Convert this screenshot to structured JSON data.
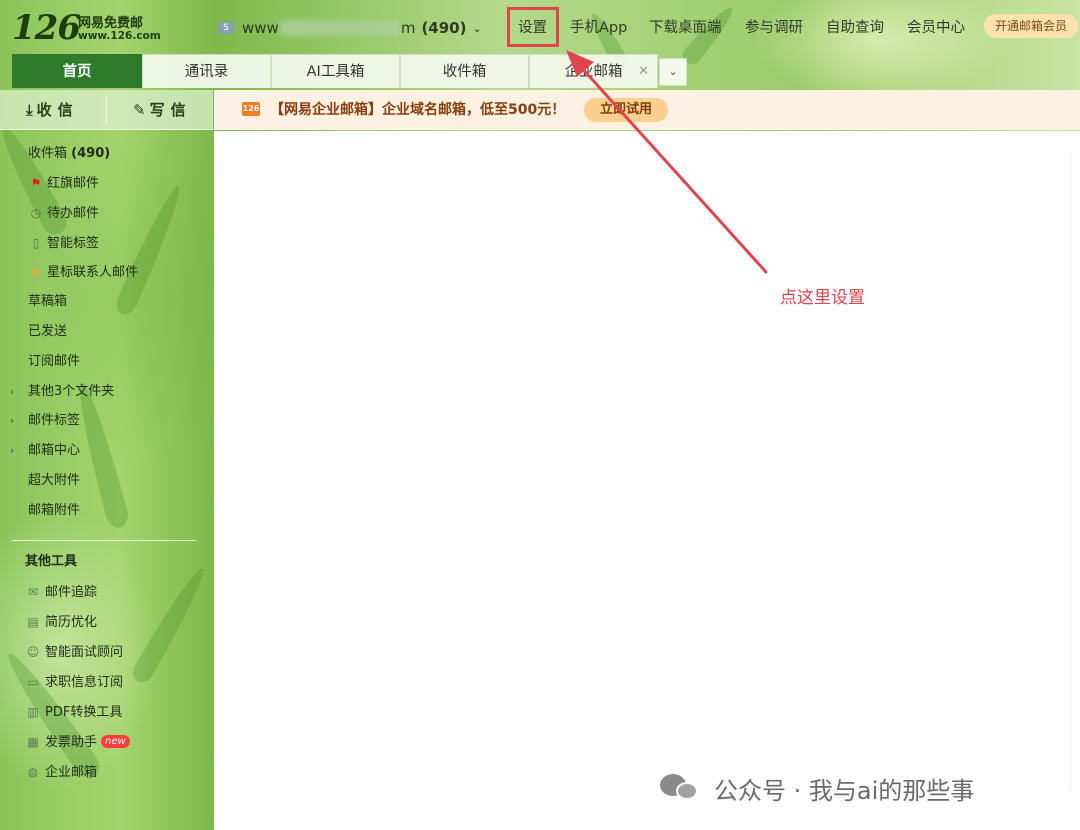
{
  "brand": {
    "logo_number": "126",
    "logo_cn": "网易免费邮",
    "logo_url": "www.126.com"
  },
  "account": {
    "prefix": "www",
    "suffix": "m",
    "count": "(490)"
  },
  "topnav": [
    "设置",
    "手机App",
    "下载桌面端",
    "参与调研",
    "自助查询",
    "会员中心"
  ],
  "vip_button": "开通邮箱会员",
  "tabs": [
    {
      "label": "首页",
      "active": true
    },
    {
      "label": "通讯录"
    },
    {
      "label": "AI工具箱"
    },
    {
      "label": "收件箱"
    },
    {
      "label": "企业邮箱",
      "closable": true
    }
  ],
  "sidebar": {
    "receive_label": "收信",
    "write_label": "写信",
    "folders": [
      {
        "label": "收件箱",
        "count": "(490)",
        "icon": "none"
      },
      {
        "label": "红旗邮件",
        "icon": "red-flag-icon"
      },
      {
        "label": "待办邮件",
        "icon": "clock-icon"
      },
      {
        "label": "智能标签",
        "icon": "bookmark-icon"
      },
      {
        "label": "星标联系人邮件",
        "icon": "star-icon"
      },
      {
        "label": "草稿箱"
      },
      {
        "label": "已发送"
      },
      {
        "label": "订阅邮件"
      },
      {
        "label": "其他3个文件夹",
        "expandable": true
      },
      {
        "label": "邮件标签",
        "expandable": true
      },
      {
        "label": "邮箱中心",
        "expandable": true
      },
      {
        "label": "超大附件"
      },
      {
        "label": "邮箱附件"
      }
    ],
    "tools_title": "其他工具",
    "tools": [
      {
        "label": "邮件追踪",
        "icon": "envelope-track-icon"
      },
      {
        "label": "简历优化",
        "icon": "resume-icon"
      },
      {
        "label": "智能面试顾问",
        "icon": "interview-icon"
      },
      {
        "label": "求职信息订阅",
        "icon": "briefcase-icon"
      },
      {
        "label": "PDF转换工具",
        "icon": "pdf-icon"
      },
      {
        "label": "发票助手",
        "icon": "invoice-icon",
        "badge": "new"
      },
      {
        "label": "企业邮箱",
        "icon": "globe-icon"
      }
    ]
  },
  "promo": {
    "icon_text": "126",
    "text": "【网易企业邮箱】企业域名邮箱，低至500元！",
    "button": "立即试用"
  },
  "annotation": {
    "text": "点这里设置",
    "color": "#e0444e"
  },
  "watermark": {
    "text": "公众号 · 我与ai的那些事"
  },
  "colors": {
    "active_tab": "#2f7a2b",
    "promo_bg": "#fdf1e3",
    "vip_button_bg": "#fde2b0",
    "annotation": "#e0444e"
  }
}
